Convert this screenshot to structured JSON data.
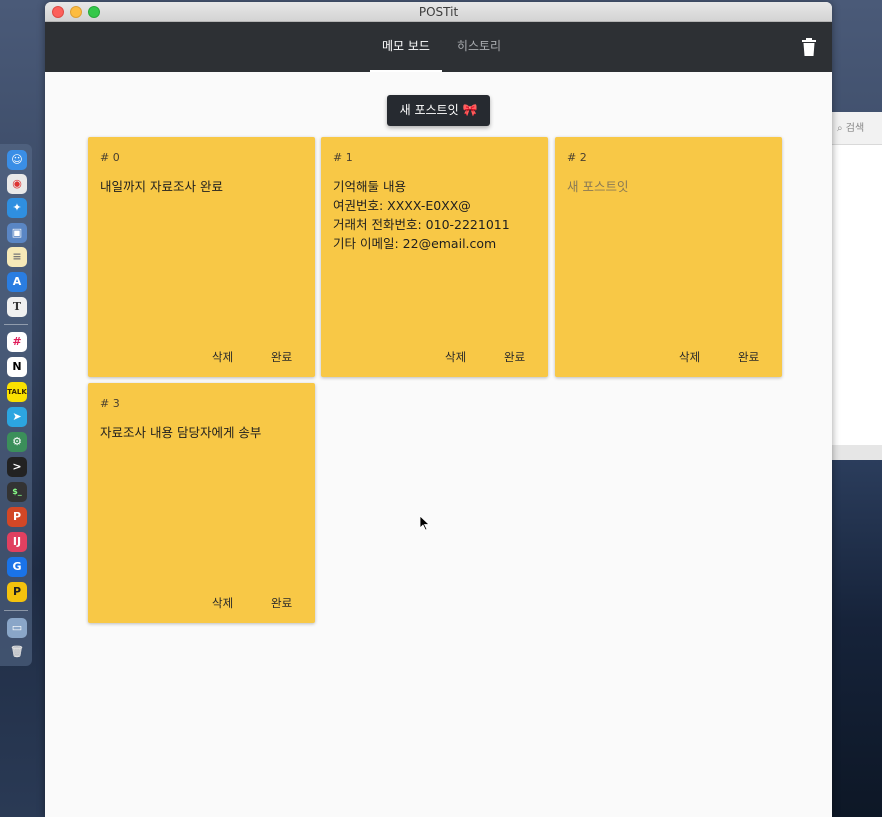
{
  "window": {
    "title": "POSTit"
  },
  "tabs": [
    {
      "label": "메모 보드",
      "active": true
    },
    {
      "label": "히스토리",
      "active": false
    }
  ],
  "toolbar": {
    "trash_icon": "trash-icon"
  },
  "new_button": {
    "label": "새 포스트잇 🎀"
  },
  "notes": [
    {
      "number": "# 0",
      "text": "내일까지 자료조사 완료",
      "placeholder": false,
      "delete_label": "삭제",
      "done_label": "완료"
    },
    {
      "number": "# 1",
      "text": "기억해둘 내용\n여권번호: XXXX-E0XX@\n거래처 전화번호: 010-2221011\n기타 이메일: 22@email.com",
      "placeholder": false,
      "delete_label": "삭제",
      "done_label": "완료"
    },
    {
      "number": "# 2",
      "text": "새 포스트잇",
      "placeholder": true,
      "delete_label": "삭제",
      "done_label": "완료"
    },
    {
      "number": "# 3",
      "text": "자료조사 내용 담당자에게 송부",
      "placeholder": false,
      "delete_label": "삭제",
      "done_label": "완료"
    }
  ],
  "background_window": {
    "search_placeholder": "검색"
  },
  "colors": {
    "appbar": "#2d3034",
    "note": "#f8c846",
    "button": "#262a30"
  }
}
